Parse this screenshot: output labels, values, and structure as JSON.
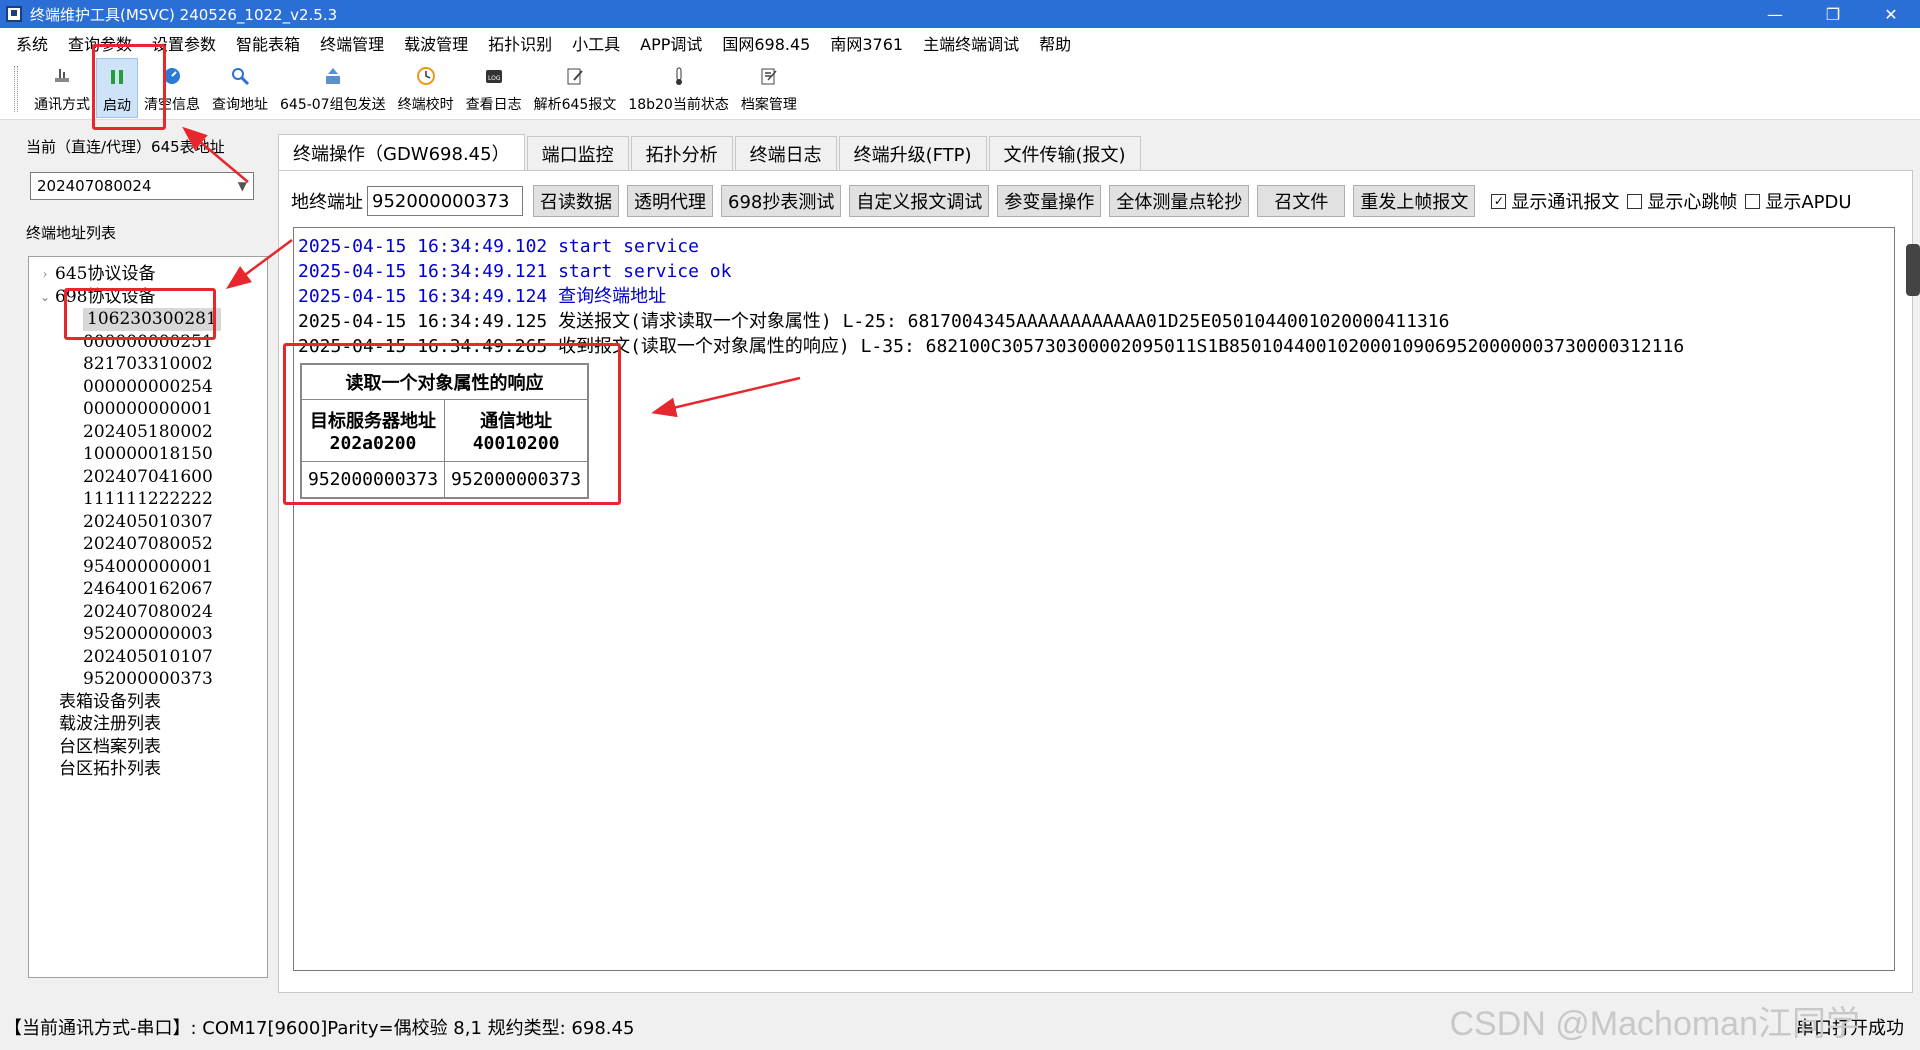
{
  "window": {
    "title": "终端维护工具(MSVC) 240526_1022_v2.5.3",
    "minimize": "—",
    "maximize": "❐",
    "close": "✕"
  },
  "menu": [
    "系统",
    "查询参数",
    "设置参数",
    "智能表箱",
    "终端管理",
    "载波管理",
    "拓扑识别",
    "小工具",
    "APP调试",
    "国网698.45",
    "南网3761",
    "主端终端调试",
    "帮助"
  ],
  "toolbar": [
    {
      "label": "通讯方式",
      "icon": "plug-icon"
    },
    {
      "label": "启动",
      "icon": "pause-icon"
    },
    {
      "label": "清空信息",
      "icon": "gauge-icon"
    },
    {
      "label": "查询地址",
      "icon": "search-icon"
    },
    {
      "label": "645-07组包发送",
      "icon": "upload-icon"
    },
    {
      "label": "终端校时",
      "icon": "clock-icon"
    },
    {
      "label": "查看日志",
      "icon": "log-icon"
    },
    {
      "label": "解析645报文",
      "icon": "edit-icon"
    },
    {
      "label": "18b20当前状态",
      "icon": "thermometer-icon"
    },
    {
      "label": "档案管理",
      "icon": "archive-icon"
    }
  ],
  "left": {
    "current_label": "当前（直连/代理）645表地址",
    "current_value": "202407080024",
    "list_label": "终端地址列表",
    "groups": [
      {
        "label": "645协议设备",
        "expand": "›"
      },
      {
        "label": "698协议设备",
        "expand": "⌄"
      }
    ],
    "addresses": [
      "106230300281",
      "000000000251",
      "821703310002",
      "000000000254",
      "000000000001",
      "202405180002",
      "100000018150",
      "202407041600",
      "111111222222",
      "202405010307",
      "202407080052",
      "954000000001",
      "246400162067",
      "202407080024",
      "952000000003",
      "202405010107",
      "952000000373"
    ],
    "others": [
      "表箱设备列表",
      "载波注册列表",
      "台区档案列表",
      "台区拓扑列表"
    ]
  },
  "tabs": [
    "终端操作（GDW698.45）",
    "端口监控",
    "拓扑分析",
    "终端日志",
    "终端升级(FTP)",
    "文件传输(报文)"
  ],
  "controls": {
    "addr_label": "地终端址",
    "addr_value": "952000000373",
    "buttons": [
      "召读数据",
      "透明代理",
      "698抄表测试",
      "自定义报文调试",
      "参变量操作",
      "全体测量点轮抄",
      "召文件",
      "重发上帧报文"
    ],
    "checkboxes": [
      {
        "label": "显示通讯报文",
        "checked": true,
        "mark": "✓"
      },
      {
        "label": "显示心跳帧",
        "checked": false,
        "mark": ""
      },
      {
        "label": "显示APDU",
        "checked": false,
        "mark": ""
      }
    ]
  },
  "log": [
    {
      "text": "2025-04-15 16:34:49.102 start service",
      "color": "#0000d0"
    },
    {
      "text": "2025-04-15 16:34:49.121 start service ok",
      "color": "#0000d0"
    },
    {
      "text": "2025-04-15 16:34:49.124 查询终端地址",
      "color": "#0000d0"
    },
    {
      "text": "2025-04-15 16:34:49.125 发送报文(请求读取一个对象属性) L-25: 6817004345AAAAAAAAAAAA01D25E0501044001020000411316",
      "color": "#000000"
    },
    {
      "text": "2025-04-15 16:34:49.265 收到报文(读取一个对象属性的响应) L-35: 682100C305730300002095011S1B850104400102000109069520000003730000312116",
      "color": "#000000"
    }
  ],
  "response_table": {
    "caption": "读取一个对象属性的响应",
    "headers": [
      {
        "name": "目标服务器地址",
        "code": "202a0200"
      },
      {
        "name": "通信地址",
        "code": "40010200"
      }
    ],
    "row": [
      "952000000373",
      "952000000373"
    ]
  },
  "status": {
    "left": "【当前通讯方式-串口】: COM17[9600]Parity=偶校验 8,1 规约类型: 698.45",
    "right": "串口打开成功",
    "watermark": "CSDN @Machoman江同学"
  },
  "colors": {
    "titlebar": "#2b6fd6",
    "annotation": "#e8262e",
    "log_info": "#0000d0"
  }
}
